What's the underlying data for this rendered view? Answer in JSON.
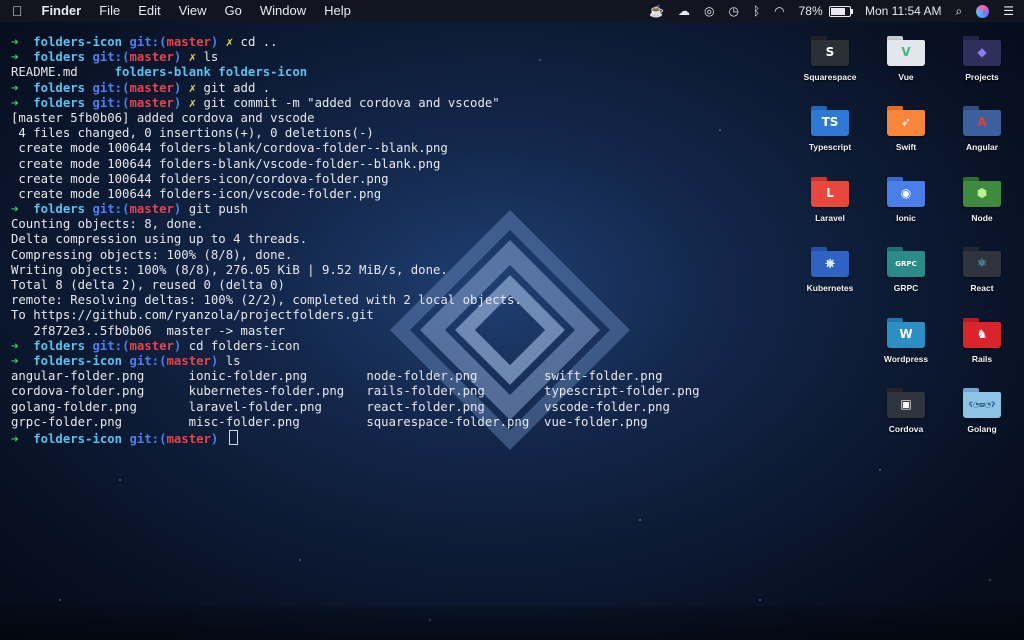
{
  "menubar": {
    "app_name": "Finder",
    "menus": [
      "File",
      "Edit",
      "View",
      "Go",
      "Window",
      "Help"
    ],
    "battery_percent": "78%",
    "battery_level": 0.78,
    "clock": "Mon 11:54 AM",
    "tray_icons": [
      "homebrew-icon",
      "cloud-icon",
      "creative-cloud-icon",
      "time-machine-icon",
      "bluetooth-icon",
      "wifi-icon",
      "battery-icon",
      "search-icon",
      "siri-icon",
      "notification-center-icon"
    ]
  },
  "terminal": {
    "prompt_arrow": "➜",
    "git_label": "git:(",
    "git_close": ")",
    "branch": "master",
    "dirty_mark": "✗",
    "prompts": [
      {
        "dir": "folders-icon",
        "dirty": true,
        "cmd": "cd .."
      },
      {
        "dir": "folders",
        "dirty": true,
        "cmd": "ls"
      },
      {
        "dir": "folders",
        "dirty": true,
        "cmd": "git add ."
      },
      {
        "dir": "folders",
        "dirty": true,
        "cmd": "git commit -m \"added cordova and vscode\""
      },
      {
        "dir": "folders",
        "dirty": false,
        "cmd": "git push"
      },
      {
        "dir": "folders",
        "dirty": false,
        "cmd": "cd folders-icon"
      },
      {
        "dir": "folders-icon",
        "dirty": false,
        "cmd": "ls"
      },
      {
        "dir": "folders-icon",
        "dirty": false,
        "cmd": ""
      }
    ],
    "ls_root": {
      "file": "README.md",
      "dirs": "folders-blank folders-icon"
    },
    "commit_output": [
      "[master 5fb0b06] added cordova and vscode",
      " 4 files changed, 0 insertions(+), 0 deletions(-)",
      " create mode 100644 folders-blank/cordova-folder--blank.png",
      " create mode 100644 folders-blank/vscode-folder--blank.png",
      " create mode 100644 folders-icon/cordova-folder.png",
      " create mode 100644 folders-icon/vscode-folder.png"
    ],
    "push_output": [
      "Counting objects: 8, done.",
      "Delta compression using up to 4 threads.",
      "Compressing objects: 100% (8/8), done.",
      "Writing objects: 100% (8/8), 276.05 KiB | 9.52 MiB/s, done.",
      "Total 8 (delta 2), reused 0 (delta 0)",
      "remote: Resolving deltas: 100% (2/2), completed with 2 local objects.",
      "To https://github.com/ryanzola/projectfolders.git",
      "   2f872e3..5fb0b06  master -> master"
    ],
    "ls_icons": [
      "angular-folder.png      ionic-folder.png        node-folder.png         swift-folder.png",
      "cordova-folder.png      kubernetes-folder.png   rails-folder.png        typescript-folder.png",
      "golang-folder.png       laravel-folder.png      react-folder.png        vscode-folder.png",
      "grpc-folder.png         misc-folder.png         squarespace-folder.png  vue-folder.png"
    ]
  },
  "desktop_icons": [
    {
      "label": "Squarespace",
      "glyph": "S",
      "icon": "squarespace-folder-icon",
      "color": "#2b2f36",
      "tab": "#1f2228"
    },
    {
      "label": "Vue",
      "glyph": "V",
      "icon": "vue-folder-icon",
      "color": "#e3e6ea",
      "tab": "#c7ccd2",
      "glyph_color": "#41b883"
    },
    {
      "label": "Projects",
      "glyph": "◆",
      "icon": "projects-folder-icon",
      "color": "#2f2f5c",
      "tab": "#24244a",
      "glyph_color": "#8e7dff"
    },
    {
      "label": "Typescript",
      "glyph": "TS",
      "icon": "typescript-folder-icon",
      "color": "#2d7ad6",
      "tab": "#2466b6"
    },
    {
      "label": "Swift",
      "glyph": "➶",
      "icon": "swift-folder-icon",
      "color": "#f7863a",
      "tab": "#df6e26"
    },
    {
      "label": "Angular",
      "glyph": "A",
      "icon": "angular-folder-icon",
      "color": "#3c5f9e",
      "tab": "#2f4f86",
      "glyph_color": "#e23b3b"
    },
    {
      "label": "Laravel",
      "glyph": "L",
      "icon": "laravel-folder-icon",
      "color": "#e8473b",
      "tab": "#c9382e"
    },
    {
      "label": "Ionic",
      "glyph": "◉",
      "icon": "ionic-folder-icon",
      "color": "#4a7ee8",
      "tab": "#3c69c8"
    },
    {
      "label": "Node",
      "glyph": "⬢",
      "icon": "node-folder-icon",
      "color": "#3e8a3e",
      "tab": "#2f6e30",
      "glyph_color": "#b9f28a"
    },
    {
      "label": "Kubernetes",
      "glyph": "⎈",
      "icon": "kubernetes-folder-icon",
      "color": "#2e63c4",
      "tab": "#2552a6"
    },
    {
      "label": "GRPC",
      "glyph": "GRPC",
      "icon": "grpc-folder-icon",
      "color": "#2a8b88",
      "tab": "#1f706e"
    },
    {
      "label": "React",
      "glyph": "⚛",
      "icon": "react-folder-icon",
      "color": "#2f333b",
      "tab": "#24272d",
      "glyph_color": "#61dafb"
    },
    {
      "label": "Wordpress",
      "glyph": "W",
      "icon": "wordpress-folder-icon",
      "color": "#2c8fc4",
      "tab": "#2277a6"
    },
    {
      "label": "Rails",
      "glyph": "♞",
      "icon": "rails-folder-icon",
      "color": "#d8242a",
      "tab": "#b71c21"
    },
    {
      "label": "Cordova",
      "glyph": "▣",
      "icon": "cordova-folder-icon",
      "color": "#30343c",
      "tab": "#23262c"
    },
    {
      "label": "Golang",
      "glyph": "ʕ◔ϖ◔ʔ",
      "icon": "golang-folder-icon",
      "color": "#8fc3e6",
      "tab": "#6fa9d2",
      "glyph_color": "#2b5f86"
    }
  ]
}
